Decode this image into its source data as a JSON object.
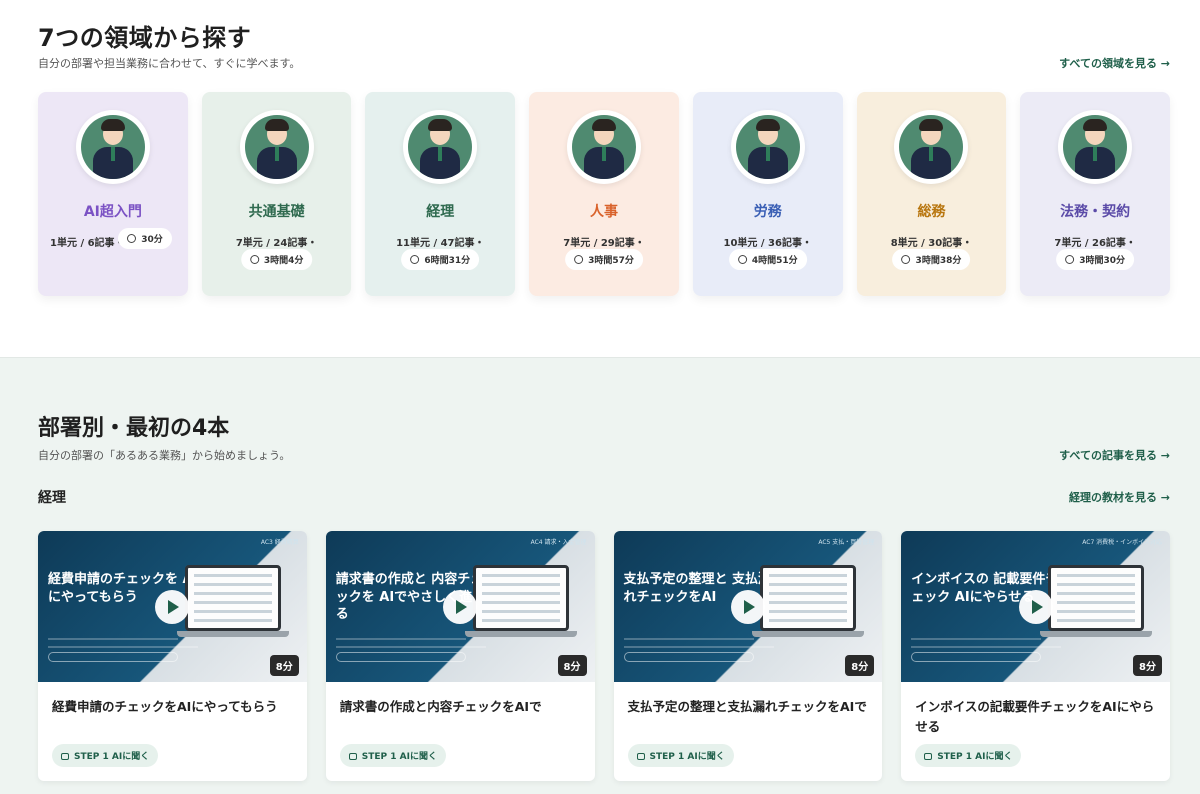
{
  "section1": {
    "title": "7つの領域から探す",
    "subtitle": "自分の部署や担当業務に合わせて、すぐに学べます。",
    "see_all": "すべての領域を見る →",
    "domains": [
      {
        "name": "AI超入門",
        "stats": "1単元 / 6記事・",
        "time": "30分",
        "color": "#7b52c4",
        "bg": "#ede7f6"
      },
      {
        "name": "共通基礎",
        "stats": "7単元 / 24記事・",
        "time": "3時間4分",
        "color": "#2f6a4f",
        "bg": "#e7f0ea"
      },
      {
        "name": "経理",
        "stats": "11単元 / 47記事・",
        "time": "6時間31分",
        "color": "#2f6a4f",
        "bg": "#e5f0ee"
      },
      {
        "name": "人事",
        "stats": "7単元 / 29記事・",
        "time": "3時間57分",
        "color": "#d9622b",
        "bg": "#fcebe2"
      },
      {
        "name": "労務",
        "stats": "10単元 / 36記事・",
        "time": "4時間51分",
        "color": "#3a5fb5",
        "bg": "#e8ecf8"
      },
      {
        "name": "総務",
        "stats": "8単元 / 30記事・",
        "time": "3時間38分",
        "color": "#b8760f",
        "bg": "#f8eedd"
      },
      {
        "name": "法務・契約",
        "stats": "7単元 / 26記事・",
        "time": "3時間30分",
        "color": "#5b4ba8",
        "bg": "#ecebf6"
      }
    ]
  },
  "section2": {
    "title": "部署別・最初の4本",
    "subtitle": "自分の部署の「あるある業務」から始めましょう。",
    "see_all": "すべての記事を見る →",
    "category": "経理",
    "category_link": "経理の教材を見る →",
    "videos": [
      {
        "tag": "AC3 経費精算",
        "thumb_title": "経費申請のチェックを AIにやってもらう",
        "duration": "8分",
        "title": "経費申請のチェックをAIにやってもらう",
        "step": "STEP 1 AIに聞く"
      },
      {
        "tag": "AC4 請求・入金管理",
        "thumb_title": "請求書の作成と 内容チェックを AIでやさしく進める",
        "duration": "8分",
        "title": "請求書の作成と内容チェックをAIで",
        "step": "STEP 1 AIに聞く"
      },
      {
        "tag": "AC5 支払・買掛管理",
        "thumb_title": "支払予定の整理と 支払漏れチェックをAI",
        "duration": "8分",
        "title": "支払予定の整理と支払漏れチェックをAIで",
        "step": "STEP 1 AIに聞く"
      },
      {
        "tag": "AC7 消費税・インボイス対応",
        "thumb_title": "インボイスの 記載要件チェック AIにやらせる",
        "duration": "8分",
        "title": "インボイスの記載要件チェックをAIにやらせる",
        "step": "STEP 1 AIに聞く"
      }
    ]
  }
}
